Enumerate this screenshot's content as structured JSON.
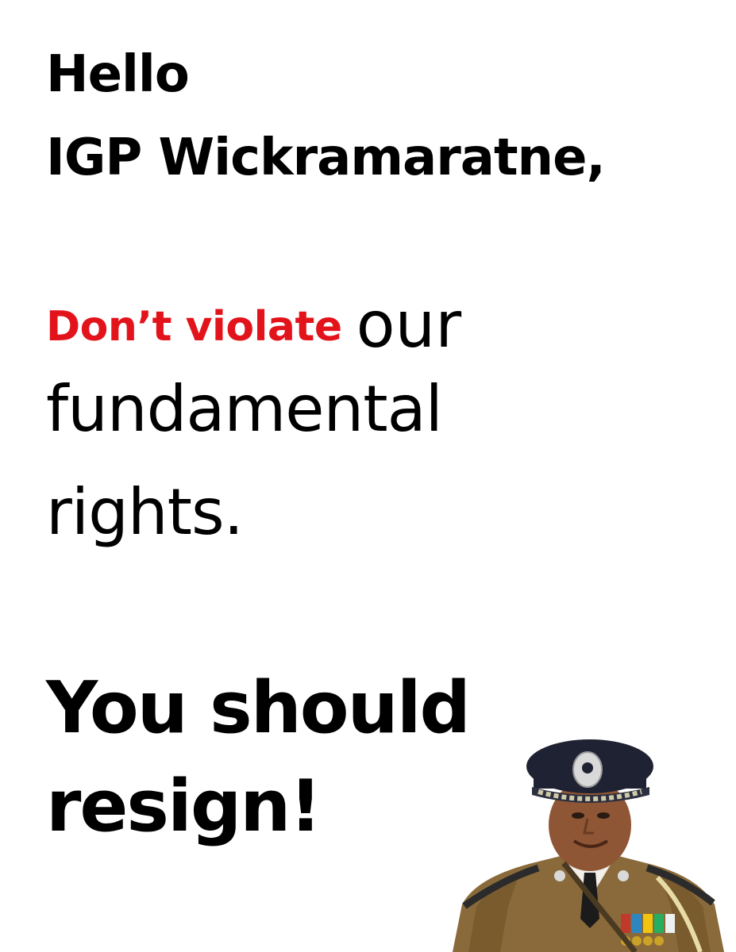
{
  "poster": {
    "greeting_line1": "Hello",
    "greeting_line2": "IGP Wickramaratne,",
    "demand_red": "Don’t violate",
    "demand_rest": "our",
    "body_line2": "fundamental",
    "body_line3": "rights.",
    "closing_line1": "You should",
    "closing_line2": "resign!"
  },
  "colors": {
    "background": "#ffffff",
    "text": "#000000",
    "accent_red": "#e3131b",
    "uniform_khaki": "#8a6a3a",
    "cap_navy": "#1f2233"
  },
  "icons": {
    "portrait": "police-officer-portrait"
  }
}
